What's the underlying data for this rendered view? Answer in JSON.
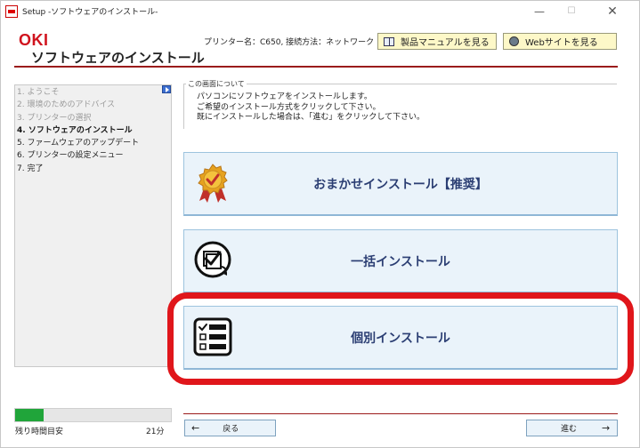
{
  "window": {
    "title": "Setup -ソフトウェアのインストール-",
    "controls": {
      "minimize": "—",
      "maximize": "☐",
      "close": "✕"
    }
  },
  "header": {
    "brand": "OKI",
    "title": "ソフトウェアのインストール",
    "printer_info": "プリンター名：C650, 接続方法：ネットワーク",
    "manual_button": "製品マニュアルを見る",
    "web_button": "Webサイトを見る"
  },
  "sidebar": {
    "steps": [
      {
        "label": "1. ようこそ",
        "state": "done"
      },
      {
        "label": "2. 環境のためのアドバイス",
        "state": "done"
      },
      {
        "label": "3. プリンターの選択",
        "state": "done"
      },
      {
        "label": "4. ソフトウェアのインストール",
        "state": "current"
      },
      {
        "label": "5. ファームウェアのアップデート",
        "state": "todo"
      },
      {
        "label": "6. プリンターの設定メニュー",
        "state": "todo"
      },
      {
        "label": "7. 完了",
        "state": "todo"
      }
    ]
  },
  "info": {
    "legend": "この画面について",
    "lines": [
      "パソコンにソフトウェアをインストールします。",
      "ご希望のインストール方式をクリックして下さい。",
      "既にインストールした場合は、「進む」をクリックして下さい。"
    ]
  },
  "options": {
    "auto": "おまかせインストール【推奨】",
    "bulk": "一括インストール",
    "custom": "個別インストール"
  },
  "footer": {
    "time_label": "残り時間目安",
    "time_value": "21分",
    "progress": 0.18,
    "back_label": "戻る",
    "next_label": "進む",
    "back_arrow": "←",
    "next_arrow": "→"
  },
  "colors": {
    "brand_red": "#d0141e",
    "accent_line": "#9b1b1b",
    "option_bg": "#eaf3fa",
    "option_text": "#2b3e73",
    "highlight": "#e0161b",
    "progress": "#20a53a"
  }
}
